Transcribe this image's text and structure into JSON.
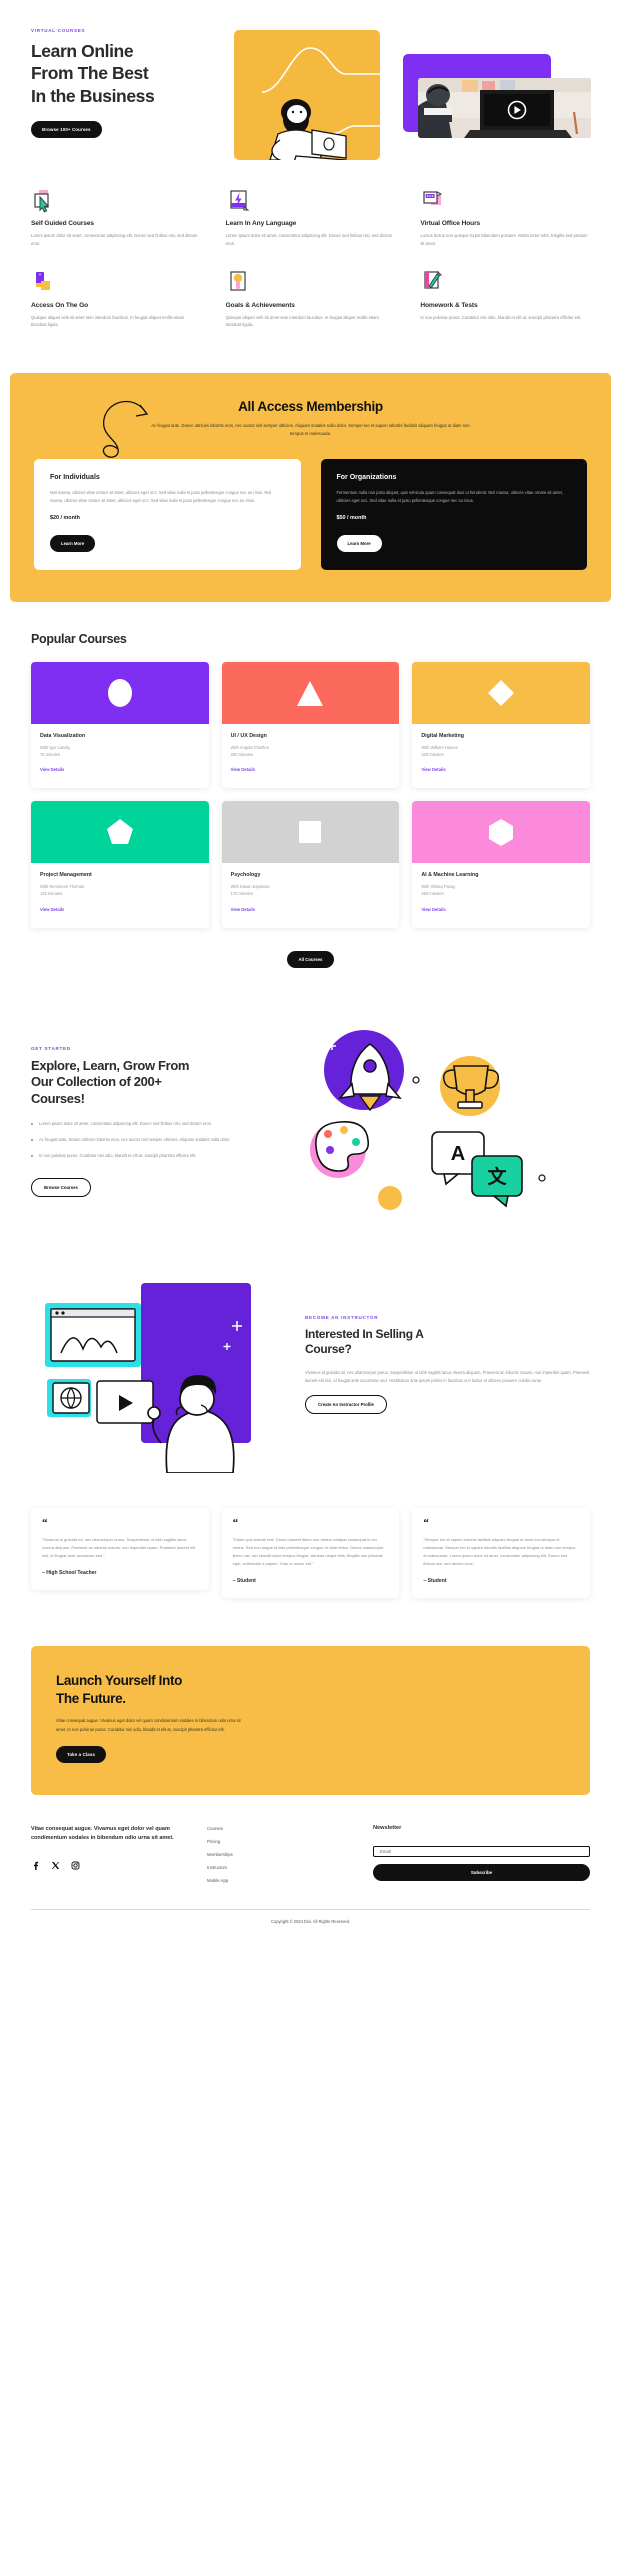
{
  "hero": {
    "eyebrow": "VIRTUAL COURSES",
    "title_line1": "Learn Online",
    "title_line2": "From The Best",
    "title_line3": "In the Business",
    "cta_label": "Browse 100+ Courses"
  },
  "features": [
    {
      "icon": "cursor-click-icon",
      "title": "Self Guided Courses",
      "desc": "Lorem ipsum dolor sit amet, consectetur adipiscing elit. Donec sed finibus nisi, sed dictum eros."
    },
    {
      "icon": "lightning-bolt-icon",
      "title": "Learn In Any Language",
      "desc": "Lorem ipsum dolor sit amet, consectetur adipiscing elit. Donec sed finibus nisi, sed dictum eros."
    },
    {
      "icon": "chat-bubble-icon",
      "title": "Virtual Office Hours",
      "desc": "Luctus lectus non quisque turpis bibendum posuere. Morbi tortor nibh, fringilla sed pretium sit amet."
    },
    {
      "icon": "mobile-device-icon",
      "title": "Access On The Go",
      "desc": "Quisque aliquet velit sit amet sem interdum faucibus. In feugiat aliquet mollis etiam tincidunt ligula."
    },
    {
      "icon": "medal-award-icon",
      "title": "Goals & Achievements",
      "desc": "Quisque aliquet velit sit amet sem interdum faucibus. In feugiat aliquet mollis etiam tincidunt ligula."
    },
    {
      "icon": "pencil-document-icon",
      "title": "Homework & Tests",
      "desc": "In non pulvinar purus. Curabitur nisi odio, blandit et elit at, suscipit pharetra efficitur elit."
    }
  ],
  "membership": {
    "title": "All Access Membership",
    "subtitle": "Ac feugiat ante. Donec ultricies lobortis eros, nec auctor nisl semper ultricies. Aliquam sodales nulla dolor. Semper leo et sapien lobortis facilisis aliquam feugiat ut diam non tempus et malesuada.",
    "plans": [
      {
        "title": "For Individuals",
        "desc": "Nisl massa, ultrices vitae ornare sit amet, ultricies eget orci. Sed vitae nulla et justo pellentesque congue nec eu risus. Nisl massa, ultrices vitae ornare sit amet, ultricies eget orci. Sed vitae nulla et justo pellentesque congue nec eu risus.",
        "price": "$20 / month",
        "cta_label": "Learn More"
      },
      {
        "title": "For Organizations",
        "desc": "Fermentum nulla non justo aliquet, quis vehicula quam consequat duis ut hendrerit. Nisl massa, ultrices vitae ornare sit amet, ultricies eget orci. Sed vitae nulla et justo pellentesque congue nec eu risus.",
        "price": "$50 / month",
        "cta_label": "Learn More"
      }
    ]
  },
  "courses": {
    "section_title": "Popular Courses",
    "link_label": "View Details",
    "all_label": "All Courses",
    "items": [
      {
        "name": "Data Visualization",
        "instructor": "With Igor Landry",
        "duration": "75 minutes",
        "color": "#7e2ff2",
        "shape": "circle"
      },
      {
        "name": "UI / UX Design",
        "instructor": "With Angela Charlton",
        "duration": "200 minutes",
        "color": "#fc6a5d",
        "shape": "triangle"
      },
      {
        "name": "Digital Marketing",
        "instructor": "With William Haines",
        "duration": "320 minutes",
        "color": "#f8bd46",
        "shape": "diamond"
      },
      {
        "name": "Project Management",
        "instructor": "With Rensmore Thomas",
        "duration": "145 minutes",
        "color": "#00d49a",
        "shape": "pentagon"
      },
      {
        "name": "Psychology",
        "instructor": "With Kason Espinosa",
        "duration": "170 minutes",
        "color": "#d2d2d2",
        "shape": "square"
      },
      {
        "name": "AI & Machine Learning",
        "instructor": "With Ishtiaq Parag",
        "duration": "260 minutes",
        "color": "#fb8ada",
        "shape": "hexagon"
      }
    ]
  },
  "explore": {
    "eyebrow": "GET STARTED",
    "title_line1": "Explore, Learn, Grow From",
    "title_line2": "Our Collection of 200+",
    "title_line3": "Courses!",
    "bullets": [
      "Lorem ipsum dolor sit amet, consectetur adipiscing elit. Donec sed finibus nisi, sed dictum eros.",
      "Ac feugiat ante. Donec ultricies lobortis eros, nec auctor nisl semper ultricies. Aliquam sodales nulla dolor.",
      "In non pulvinar purus. Curabitur nisi odio, blandit et elit at, suscipit pharetra efficitur elit."
    ],
    "cta_label": "Browse Courses"
  },
  "instructor": {
    "eyebrow": "BECOME AN INSTRUCTOR",
    "title_line1": "Interested In Selling A",
    "title_line2": "Course?",
    "desc": "Vivamus id gravida mi, nec ullamcorper purus. Suspendisse ut nibh sagittis lacus viverra aliquam. Praesent ac lobortis mauris, non imperdiet quam. Praesent laoreet elit nisi, id feugiat ante accumsan sed. Vestibulum ante ipsum primis in faucibus orci luctus et ultrices posuere cubilia curae.",
    "cta_label": "Create An Instructor Profile"
  },
  "testimonials": [
    {
      "quote": "\"Vivamus id gravida mi, nec ullamcorper purus. Suspendisse ut nibh sagittis lacus viverra aliquam. Praesent ac lobortis mauris, non imperdiet quam. Praesent laoreet elit nisi, id feugiat ante accumsan sed.\"",
      "author": "– High School Teacher"
    },
    {
      "quote": "\"Etiam quis blandit erat. Donec laoreet libero non metus volutpat consequat in vel metus. Sed non augue id felis pellentesque congue et vitae tellus. Donec ullamcorper libero nisl, nec blandit dolor tempus feugiat. Aenean neque felis, fringilla nec placerat eget, sollicitudin a sapien. Cras ut auctor elit.\"",
      "author": "– Student"
    },
    {
      "quote": "\"Semper leo et sapien lobortis facilisis aliquam feugiat ut diam non tempus et malesuada. Semper leo et sapien lobortis facilisis aliquam feugiat ut diam non tempus et malesuada. Lorem ipsum dolor sit amet, consectetur adipiscing elit. Donec sed finibus nisi, sed dictum eros.\"",
      "author": "– Student"
    }
  ],
  "cta": {
    "title_line1": "Launch Yourself Into",
    "title_line2": "The Future.",
    "desc": "Vitae consequat augue. Vivamus eget dolor vel quam condimentum sodales in bibendum odio urna sit amet. In non pulvinar purus. Curabitur nisi odio, blandit et elit at, suscipit pharetra efficitur elit.",
    "cta_label": "Take a Class"
  },
  "footer": {
    "about": "Vitae consequat augue. Vivamus eget dolor vel quam condimentum sodales in bibendum odio urna sit amet.",
    "social": [
      "facebook-icon",
      "x-twitter-icon",
      "instagram-icon"
    ],
    "links": [
      "Courses",
      "Pricing",
      "Memberships",
      "Instructors",
      "Mobile App"
    ],
    "newsletter_title": "Newsletter",
    "email_placeholder": "Email",
    "email_value": "",
    "subscribe_label": "Subscribe",
    "copyright": "Copyright © 2024 Divi. All Rights Reserved."
  },
  "colors": {
    "accent_purple": "#7e45e8",
    "brand_yellow": "#f8bd46",
    "dark": "#111111"
  }
}
